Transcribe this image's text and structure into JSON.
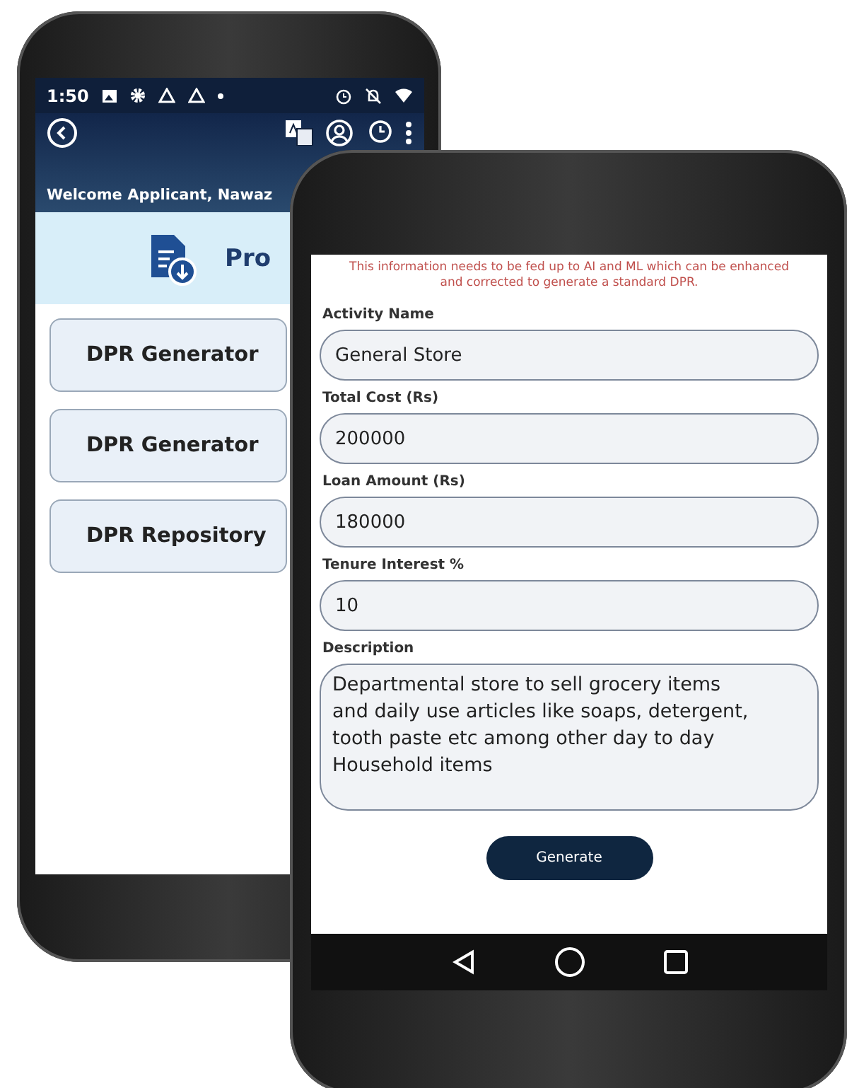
{
  "back_screen": {
    "status_bar": {
      "time": "1:50"
    },
    "header": {
      "welcome": "Welcome Applicant, Nawaz"
    },
    "banner": {
      "title": "Pro"
    },
    "menu_items": [
      {
        "label": "DPR Generator"
      },
      {
        "label": "DPR Generator"
      },
      {
        "label": "DPR Repository"
      }
    ]
  },
  "front_screen": {
    "notice": "This information needs to be fed up to AI and ML which can be enhanced and corrected to generate a standard DPR.",
    "fields": [
      {
        "label": "Activity Name",
        "value": "General Store",
        "kind": "text"
      },
      {
        "label": "Total Cost (Rs)",
        "value": "200000",
        "kind": "text"
      },
      {
        "label": "Loan Amount (Rs)",
        "value": "180000",
        "kind": "text"
      },
      {
        "label": "Tenure Interest %",
        "value": "10",
        "kind": "text"
      },
      {
        "label": "Description",
        "value": "Departmental store to sell grocery items and daily use articles like soaps, detergent, tooth paste etc among other day to day Household items",
        "kind": "multiline"
      }
    ],
    "button": "Generate"
  }
}
